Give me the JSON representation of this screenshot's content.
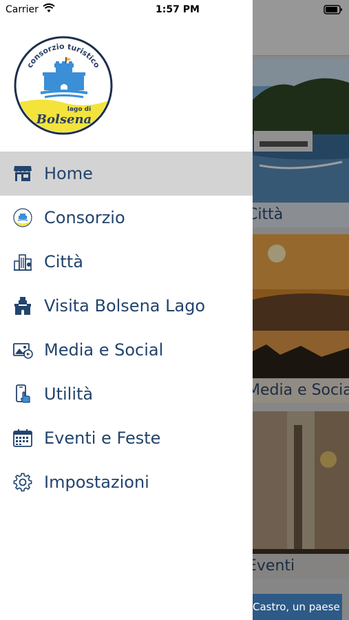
{
  "status_bar": {
    "carrier": "Carrier",
    "time": "1:57 PM"
  },
  "logo": {
    "top_text": "consorzio turistico",
    "lago_text": "lago di",
    "bolsena_text": "Bolsena"
  },
  "menu": {
    "items": [
      {
        "label": "Home",
        "icon": "store-icon",
        "active": true
      },
      {
        "label": "Consorzio",
        "icon": "consorzio-logo-icon"
      },
      {
        "label": "Città",
        "icon": "city-buildings-icon"
      },
      {
        "label": "Visita Bolsena Lago",
        "icon": "castle-tower-icon"
      },
      {
        "label": "Media e Social",
        "icon": "media-photo-icon"
      },
      {
        "label": "Utilità",
        "icon": "phone-touch-icon"
      },
      {
        "label": "Eventi e Feste",
        "icon": "calendar-icon"
      },
      {
        "label": "Impostazioni",
        "icon": "gear-icon"
      }
    ]
  },
  "background": {
    "cards": [
      {
        "label": "Città"
      },
      {
        "label": "Media e Social"
      },
      {
        "label": "Eventi"
      }
    ],
    "banner_text": "Castro, un paese"
  },
  "colors": {
    "menu_text": "#23446c",
    "active_row": "#d3d3d3",
    "logo_blue": "#3b8fd6",
    "logo_yellow": "#f3e33b"
  }
}
